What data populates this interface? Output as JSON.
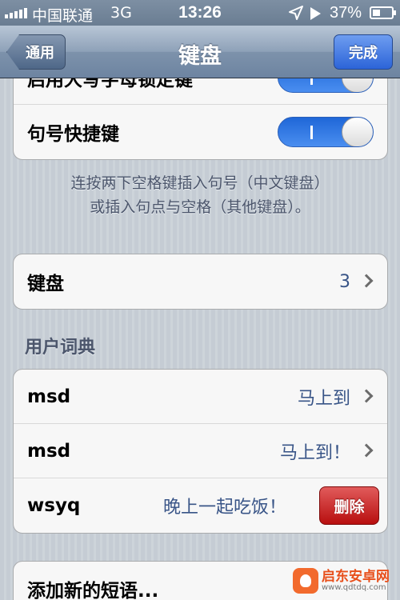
{
  "status_bar": {
    "carrier": "中国联通",
    "network": "3G",
    "time": "13:26",
    "battery_percent": "37%"
  },
  "nav": {
    "back_label": "通用",
    "title": "键盘",
    "done_label": "完成"
  },
  "toggles": [
    {
      "label": "启用大写字母锁定键",
      "on": true
    },
    {
      "label": "句号快捷键",
      "on": true
    }
  ],
  "shortcut_footnote": {
    "line1": "连按两下空格键插入句号（中文键盘）",
    "line2": "或插入句点与空格（其他键盘）。"
  },
  "keyboards_row": {
    "label": "键盘",
    "value": "3"
  },
  "user_dictionary": {
    "header": "用户词典",
    "entries": [
      {
        "shortcut": "msd",
        "phrase": "马上到"
      },
      {
        "shortcut": "msd",
        "phrase": "马上到！"
      },
      {
        "shortcut": "wsyq",
        "phrase": "晚上一起吃饭！",
        "action": "删除"
      }
    ]
  },
  "add_phrase_label": "添加新的短语...",
  "watermark": {
    "name": "启东安卓网",
    "url": "www.qdtdq.com"
  },
  "colors": {
    "nav_bar": "#7d92ab",
    "toggle_on": "#2c6ee0",
    "delete_button": "#c41a1a",
    "value_text": "#385487",
    "background": "#c5ccd4"
  }
}
